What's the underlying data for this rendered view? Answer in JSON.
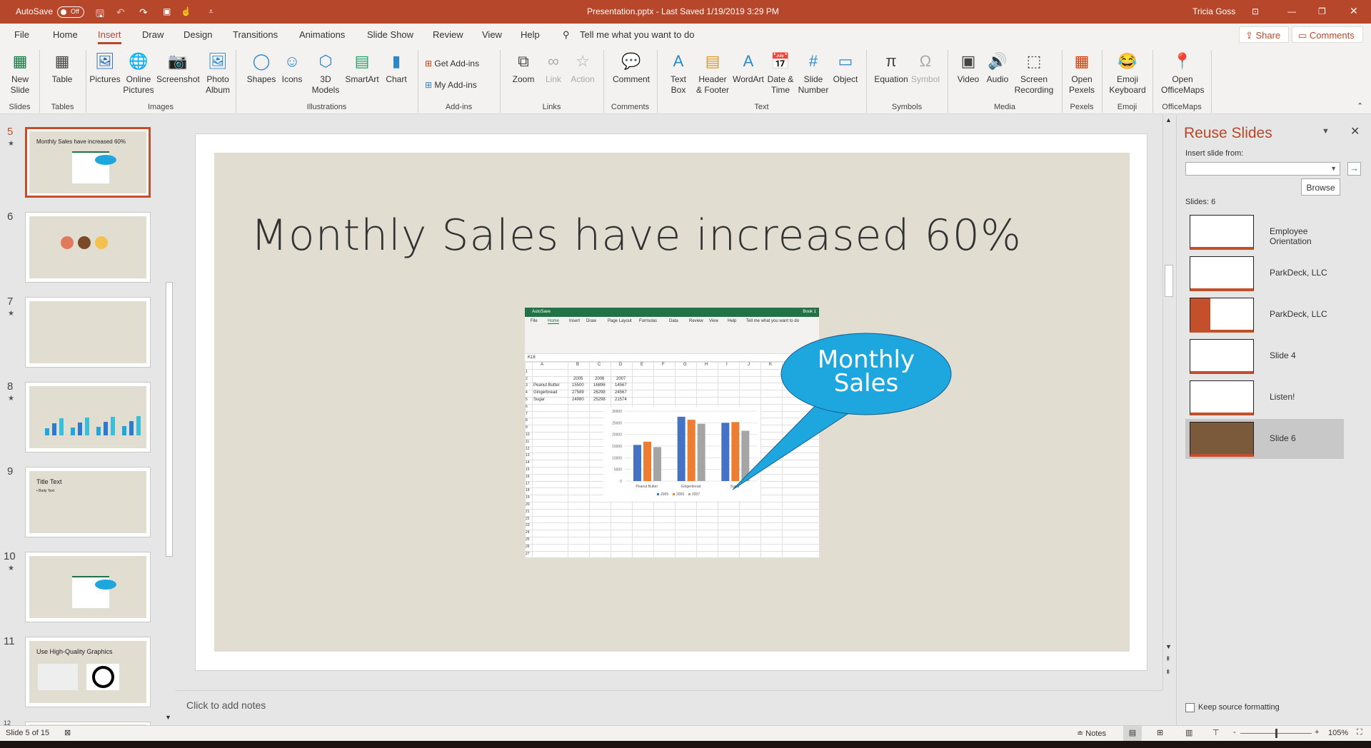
{
  "titlebar": {
    "autosave_label": "AutoSave",
    "autosave_state": "Off",
    "doc_title": "Presentation.pptx  -  Last Saved 1/19/2019 3:29 PM",
    "user": "Tricia Goss",
    "accent": "#b7472a"
  },
  "tabs": [
    "File",
    "Home",
    "Insert",
    "Draw",
    "Design",
    "Transitions",
    "Animations",
    "Slide Show",
    "Review",
    "View",
    "Help"
  ],
  "active_tab": "Insert",
  "tell_me": "Tell me what you want to do",
  "share": "Share",
  "comments": "Comments",
  "ribbon": {
    "buttons": [
      {
        "label": "New\nSlide",
        "icon": "new-slide-icon"
      },
      {
        "label": "Table",
        "icon": "table-icon"
      },
      {
        "label": "Pictures",
        "icon": "pictures-icon"
      },
      {
        "label": "Online\nPictures",
        "icon": "online-pictures-icon"
      },
      {
        "label": "Screenshot",
        "icon": "screenshot-icon"
      },
      {
        "label": "Photo\nAlbum",
        "icon": "photo-album-icon"
      },
      {
        "label": "Shapes",
        "icon": "shapes-icon"
      },
      {
        "label": "Icons",
        "icon": "icons-icon"
      },
      {
        "label": "3D\nModels",
        "icon": "3d-models-icon"
      },
      {
        "label": "SmartArt",
        "icon": "smartart-icon"
      },
      {
        "label": "Chart",
        "icon": "chart-icon"
      },
      {
        "label": "Zoom",
        "icon": "zoom-icon"
      },
      {
        "label": "Link",
        "icon": "link-icon"
      },
      {
        "label": "Action",
        "icon": "action-icon"
      },
      {
        "label": "Comment",
        "icon": "comment-icon"
      },
      {
        "label": "Text\nBox",
        "icon": "text-box-icon"
      },
      {
        "label": "Header\n& Footer",
        "icon": "header-footer-icon"
      },
      {
        "label": "WordArt",
        "icon": "wordart-icon"
      },
      {
        "label": "Date &\nTime",
        "icon": "date-time-icon"
      },
      {
        "label": "Slide\nNumber",
        "icon": "slide-number-icon"
      },
      {
        "label": "Object",
        "icon": "object-icon"
      },
      {
        "label": "Equation",
        "icon": "equation-icon"
      },
      {
        "label": "Symbol",
        "icon": "symbol-icon"
      },
      {
        "label": "Video",
        "icon": "video-icon"
      },
      {
        "label": "Audio",
        "icon": "audio-icon"
      },
      {
        "label": "Screen\nRecording",
        "icon": "screen-recording-icon"
      },
      {
        "label": "Open\nPexels",
        "icon": "pexels-icon"
      },
      {
        "label": "Emoji\nKeyboard",
        "icon": "emoji-icon"
      },
      {
        "label": "Open\nOfficeMaps",
        "icon": "map-pin-icon"
      }
    ],
    "addins": [
      "Get Add-ins",
      "My Add-ins"
    ],
    "groups": [
      "Slides",
      "Tables",
      "Images",
      "Illustrations",
      "Add-ins",
      "Links",
      "Comments",
      "Text",
      "Symbols",
      "Media",
      "Pexels",
      "Emoji",
      "OfficeMaps"
    ]
  },
  "thumbnails": [
    {
      "num": "5",
      "star": true,
      "title": "Monthly Sales have increased 60%"
    },
    {
      "num": "6",
      "star": false,
      "title": ""
    },
    {
      "num": "7",
      "star": true,
      "title": ""
    },
    {
      "num": "8",
      "star": true,
      "title": ""
    },
    {
      "num": "9",
      "star": false,
      "title": "Title Text",
      "body": "• Body Text"
    },
    {
      "num": "10",
      "star": true,
      "title": ""
    },
    {
      "num": "11",
      "star": false,
      "title": "Use High-Quality Graphics"
    },
    {
      "num": "12",
      "star": false,
      "title": ""
    }
  ],
  "slide": {
    "title": "Monthly Sales have increased 60%",
    "callout": "Monthly\nSales",
    "callout_color": "#1ea6df"
  },
  "excel": {
    "title": "Book 1",
    "autosave": "AutoSave",
    "tabs": [
      "File",
      "Home",
      "Insert",
      "Draw",
      "Page Layout",
      "Formulas",
      "Data",
      "Review",
      "View",
      "Help"
    ],
    "tell_me": "Tell me what you want to do",
    "name_box": "K18",
    "columns": [
      "A",
      "B",
      "C",
      "D",
      "E",
      "F",
      "G",
      "H",
      "I",
      "J",
      "K"
    ],
    "header_row": [
      "",
      "2005",
      "2006",
      "2007"
    ],
    "rows": [
      [
        "Peanut Butter",
        "15500",
        "16896",
        "14567"
      ],
      [
        "Gingerbread",
        "27589",
        "26298",
        "24567"
      ],
      [
        "Sugar",
        "24980",
        "25298",
        "21574"
      ]
    ]
  },
  "chart_data": {
    "type": "bar",
    "categories": [
      "Peanut Butter",
      "Gingerbread",
      "Sugar"
    ],
    "series": [
      {
        "name": "2005",
        "values": [
          15500,
          27589,
          24980
        ],
        "color": "#4472c4"
      },
      {
        "name": "2006",
        "values": [
          16896,
          26298,
          25298
        ],
        "color": "#ed7d31"
      },
      {
        "name": "2007",
        "values": [
          14567,
          24567,
          21574
        ],
        "color": "#a5a5a5"
      }
    ],
    "ylim": [
      0,
      30000
    ],
    "yticks": [
      "0",
      "5000",
      "10000",
      "15000",
      "20000",
      "25000",
      "30000"
    ],
    "grid": true,
    "legend": "bottom"
  },
  "notes_placeholder": "Click to add notes",
  "reuse": {
    "title": "Reuse Slides",
    "insert_from": "Insert slide from:",
    "browse": "Browse",
    "count": "Slides: 6",
    "keep_source": "Keep source formatting",
    "items": [
      "Employee Orientation",
      "ParkDeck, LLC",
      "ParkDeck, LLC",
      "Slide 4",
      "Listen!",
      "Slide 6"
    ]
  },
  "status": {
    "slide_info": "Slide 5 of 15",
    "notes": "Notes",
    "zoom": "105%",
    "zoom_level": 105
  }
}
